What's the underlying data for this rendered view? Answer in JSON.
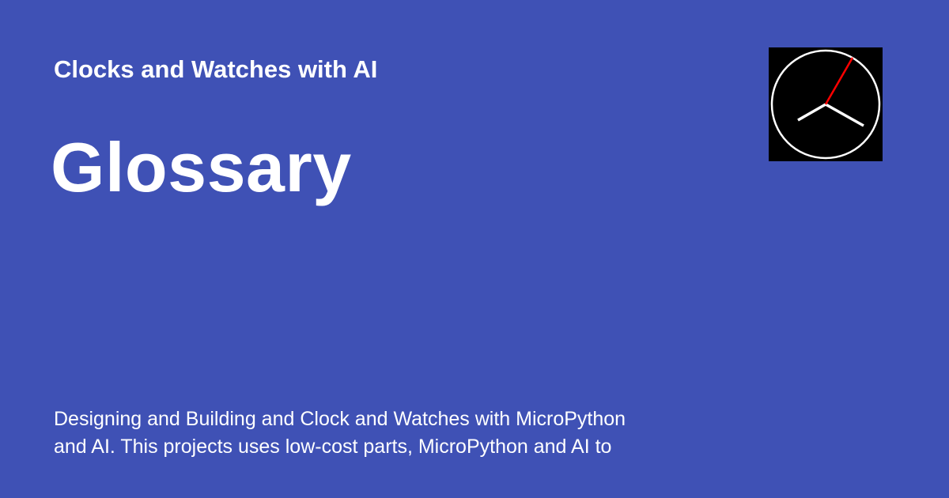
{
  "site": {
    "name": "Clocks and Watches with AI"
  },
  "page": {
    "title": "Glossary",
    "description": "Designing and Building and Clock and Watches with MicroPython\nand AI.  This projects uses low-cost parts, MicroPython and AI to"
  },
  "logo": {
    "icon": "analog-clock-icon",
    "face_color": "#000000",
    "ring_color": "#ffffff",
    "hand_color": "#ffffff",
    "second_hand_color": "#ff0000"
  },
  "colors": {
    "background": "#3f51b5",
    "text": "#ffffff"
  }
}
